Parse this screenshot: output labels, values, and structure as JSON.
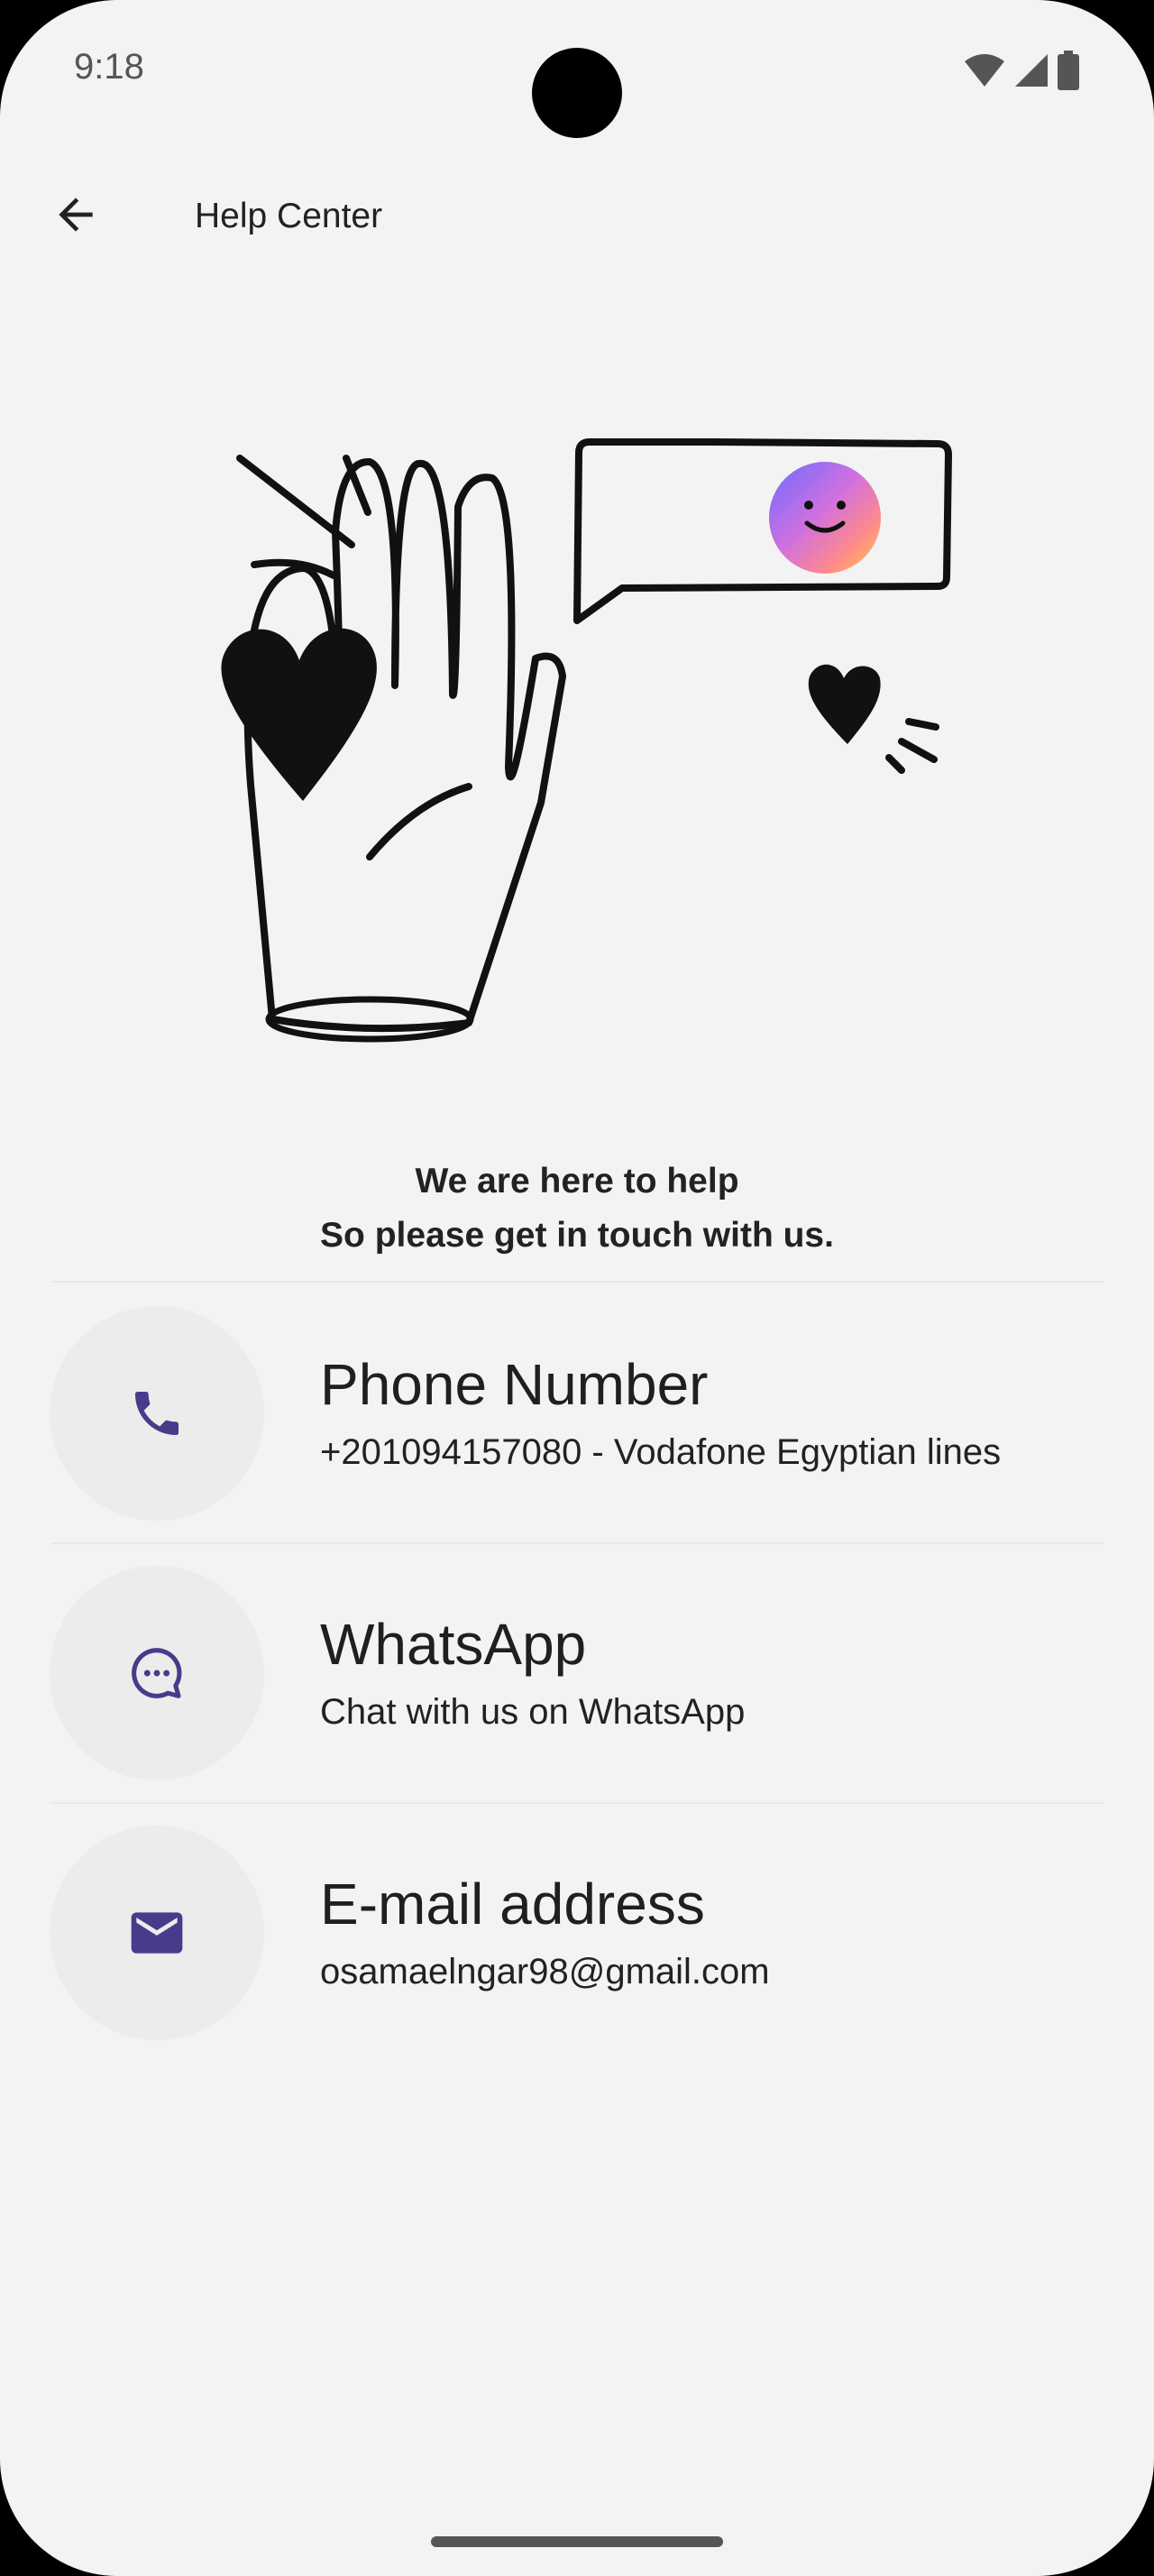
{
  "status_bar": {
    "time": "9:18",
    "icons": [
      "wifi-icon",
      "cellular-signal-icon",
      "battery-icon"
    ]
  },
  "app_bar": {
    "back_icon": "arrow-back-icon",
    "title": "Help Center"
  },
  "hero": {
    "illustration": "waving-hand-with-hearts-and-chat-bubble"
  },
  "intro": {
    "line1": "We are here to help",
    "line2": "So please get in touch with us."
  },
  "contacts": [
    {
      "icon": "phone-icon",
      "title": "Phone Number",
      "subtitle": "+201094157080 - Vodafone Egyptian lines"
    },
    {
      "icon": "chat-bubble-icon",
      "title": "WhatsApp",
      "subtitle": "Chat with us on WhatsApp"
    },
    {
      "icon": "mail-icon",
      "title": "E-mail address",
      "subtitle": "osamaelngar98@gmail.com"
    }
  ],
  "colors": {
    "background": "#f3f3f3",
    "accent": "#4a3a8c",
    "icon_circle": "#ececec",
    "text": "#1f1f1f"
  }
}
